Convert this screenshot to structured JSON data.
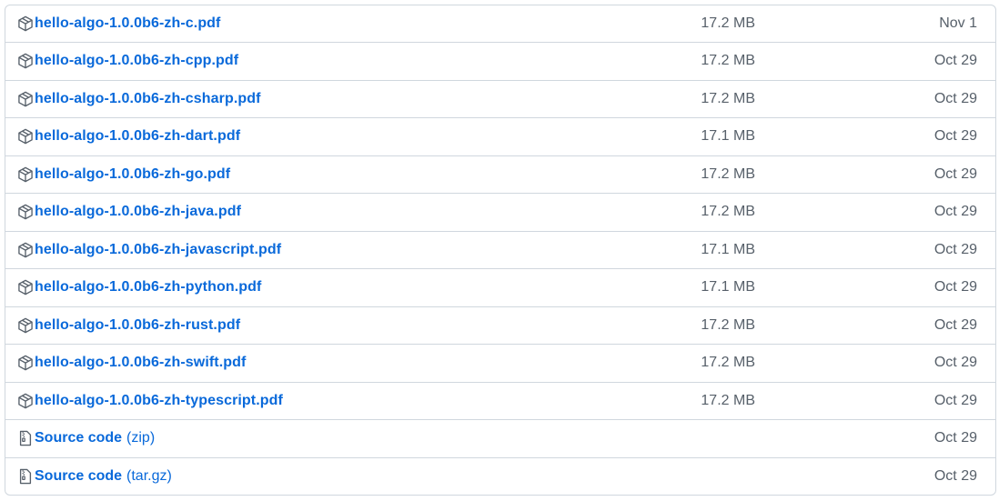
{
  "assets": [
    {
      "icon": "package-icon",
      "name": "hello-algo-1.0.0b6-zh-c.pdf",
      "size": "17.2 MB",
      "date": "Nov 1"
    },
    {
      "icon": "package-icon",
      "name": "hello-algo-1.0.0b6-zh-cpp.pdf",
      "size": "17.2 MB",
      "date": "Oct 29"
    },
    {
      "icon": "package-icon",
      "name": "hello-algo-1.0.0b6-zh-csharp.pdf",
      "size": "17.2 MB",
      "date": "Oct 29"
    },
    {
      "icon": "package-icon",
      "name": "hello-algo-1.0.0b6-zh-dart.pdf",
      "size": "17.1 MB",
      "date": "Oct 29"
    },
    {
      "icon": "package-icon",
      "name": "hello-algo-1.0.0b6-zh-go.pdf",
      "size": "17.2 MB",
      "date": "Oct 29"
    },
    {
      "icon": "package-icon",
      "name": "hello-algo-1.0.0b6-zh-java.pdf",
      "size": "17.2 MB",
      "date": "Oct 29"
    },
    {
      "icon": "package-icon",
      "name": "hello-algo-1.0.0b6-zh-javascript.pdf",
      "size": "17.1 MB",
      "date": "Oct 29"
    },
    {
      "icon": "package-icon",
      "name": "hello-algo-1.0.0b6-zh-python.pdf",
      "size": "17.1 MB",
      "date": "Oct 29"
    },
    {
      "icon": "package-icon",
      "name": "hello-algo-1.0.0b6-zh-rust.pdf",
      "size": "17.2 MB",
      "date": "Oct 29"
    },
    {
      "icon": "package-icon",
      "name": "hello-algo-1.0.0b6-zh-swift.pdf",
      "size": "17.2 MB",
      "date": "Oct 29"
    },
    {
      "icon": "package-icon",
      "name": "hello-algo-1.0.0b6-zh-typescript.pdf",
      "size": "17.2 MB",
      "date": "Oct 29"
    }
  ],
  "source": [
    {
      "icon": "file-zip-icon",
      "label": "Source code",
      "ext": "(zip)",
      "date": "Oct 29"
    },
    {
      "icon": "file-zip-icon",
      "label": "Source code",
      "ext": "(tar.gz)",
      "date": "Oct 29"
    }
  ],
  "colors": {
    "link": "#0969da",
    "muted": "#57606a",
    "border": "#d0d7de"
  }
}
